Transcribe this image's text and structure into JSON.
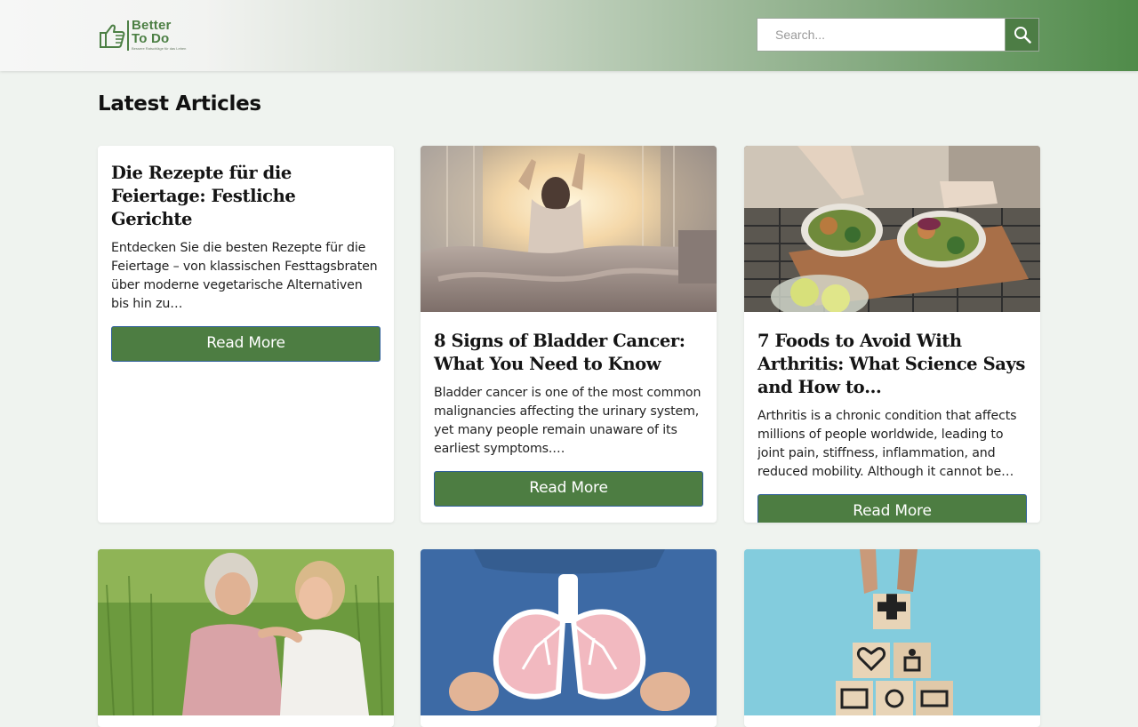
{
  "header": {
    "logo": {
      "brand_line1": "Better",
      "brand_line2": "To Do",
      "tagline": "Bessere Ratschläge für das Leben"
    },
    "search": {
      "placeholder": "Search...",
      "icon": "search-icon"
    }
  },
  "main": {
    "section_title": "Latest Articles",
    "articles": [
      {
        "title": "Die Rezepte für die Feiertage: Festliche Gerichte",
        "excerpt": "Entdecken Sie die besten Rezepte für die Feiertage – von klassischen Festtagsbraten über moderne vegetarische Alternativen bis hin zu…",
        "button": "Read More",
        "image": "none"
      },
      {
        "title": "8 Signs of Bladder Cancer: What You Need to Know",
        "excerpt": "Bladder cancer is one of the most common malignancies affecting the urinary system, yet many people remain unaware of its earliest symptoms.…",
        "button": "Read More",
        "image": "woman-stretching-in-bed-photo"
      },
      {
        "title": "7 Foods to Avoid With Arthritis: What Science Says and How to…",
        "excerpt": "Arthritis is a chronic condition that affects millions of people worldwide, leading to joint pain, stiffness, inflammation, and reduced mobility. Although it cannot be…",
        "button": "Read More",
        "image": "healthy-bowls-photo"
      },
      {
        "image": "two-women-walking-photo"
      },
      {
        "image": "paper-lungs-photo"
      },
      {
        "image": "health-icon-blocks-photo"
      }
    ]
  },
  "colors": {
    "accent_green": "#4d7d42",
    "button_border": "#2f5f9a",
    "page_background": "#eff3ef"
  }
}
